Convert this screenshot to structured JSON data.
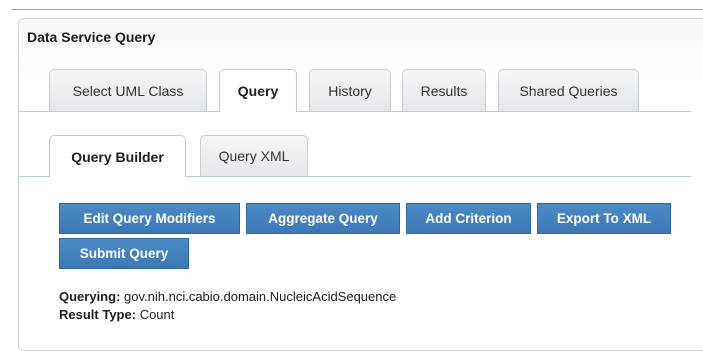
{
  "panel": {
    "title": "Data Service Query"
  },
  "main_tabs": [
    {
      "label": "Select UML Class"
    },
    {
      "label": "Query"
    },
    {
      "label": "History"
    },
    {
      "label": "Results"
    },
    {
      "label": "Shared Queries"
    }
  ],
  "sub_tabs": [
    {
      "label": "Query Builder"
    },
    {
      "label": "Query XML"
    }
  ],
  "buttons": {
    "edit_modifiers": "Edit Query Modifiers",
    "aggregate": "Aggregate Query",
    "add_criterion": "Add Criterion",
    "export_xml": "Export To XML",
    "submit": "Submit Query"
  },
  "info": {
    "querying_label": "Querying:",
    "querying_value": "gov.nih.nci.cabio.domain.NucleicAcidSequence",
    "result_type_label": "Result Type:",
    "result_type_value": "Count"
  },
  "colors": {
    "button_blue": "#3c78b5",
    "tab_border": "#b9cde2"
  }
}
